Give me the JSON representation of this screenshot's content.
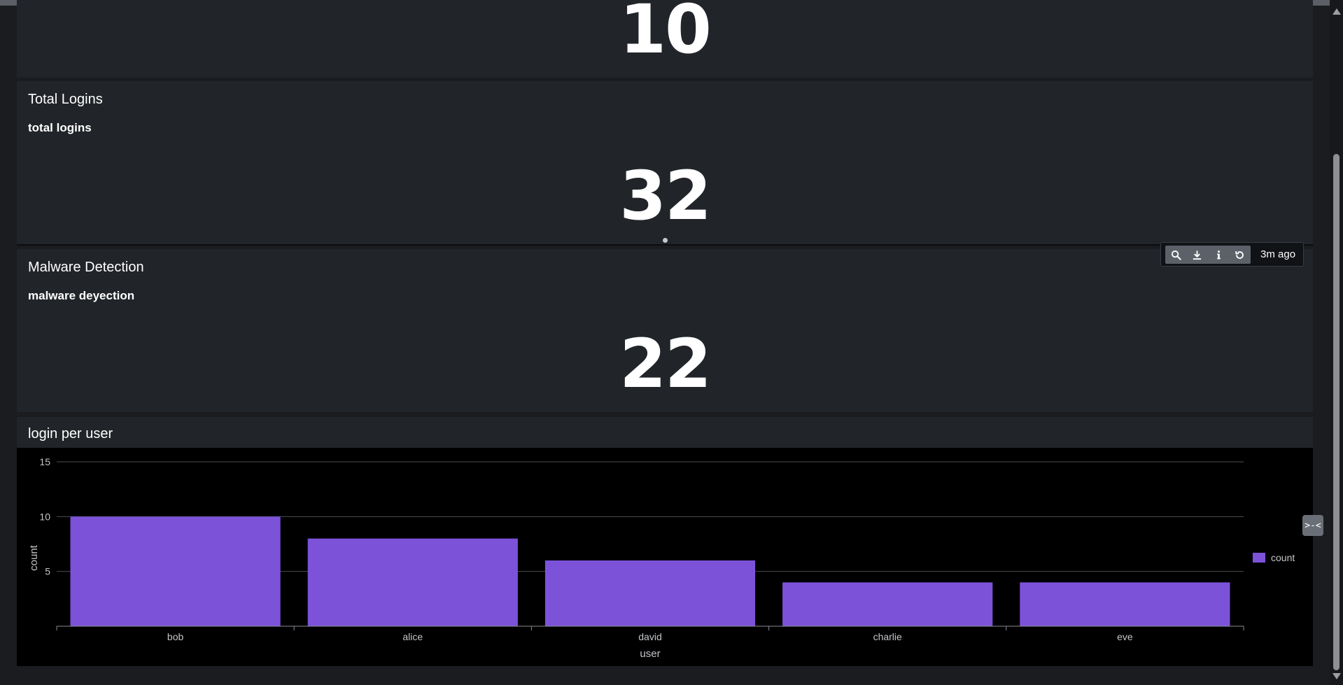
{
  "panels": {
    "top_value": "10",
    "total_logins": {
      "title": "Total Logins",
      "subtitle": "total logins",
      "value": "32"
    },
    "malware": {
      "title": "Malware Detection",
      "subtitle": "malware deyection",
      "value": "22"
    },
    "login_chart": {
      "title": "login per user"
    }
  },
  "toolbar": {
    "time_label": "3m ago",
    "icons": [
      "search-icon",
      "download-icon",
      "info-icon",
      "refresh-icon"
    ]
  },
  "side_toggle_label": ">-<",
  "colors": {
    "bar": "#7c52d9",
    "panel_bg": "#212428",
    "page_bg": "#1a1c20",
    "chart_bg": "#000000"
  },
  "chart_data": {
    "type": "bar",
    "categories": [
      "bob",
      "alice",
      "david",
      "charlie",
      "eve"
    ],
    "series": [
      {
        "name": "count",
        "values": [
          10,
          8,
          6,
          4,
          4
        ]
      }
    ],
    "xlabel": "user",
    "ylabel": "count",
    "ylim": [
      0,
      15
    ],
    "yticks": [
      5,
      10,
      15
    ],
    "grid": true,
    "legend": "right"
  }
}
